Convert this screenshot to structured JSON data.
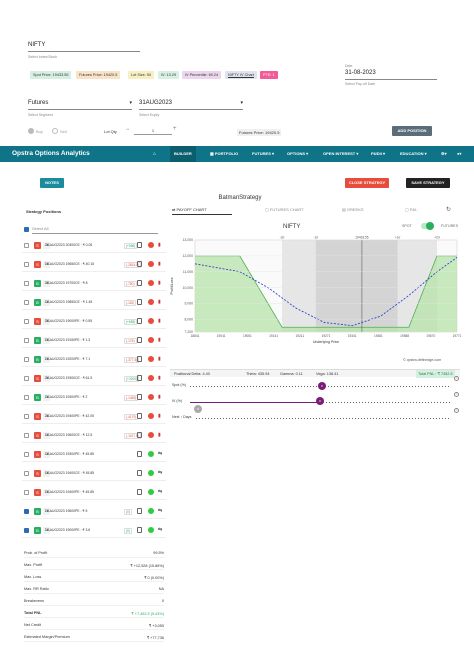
{
  "top": {
    "symbol": "NIFTY",
    "symbol_caption": "Select Index/Stock",
    "date_caption": "Date",
    "date": "31-08-2023",
    "date_sub": "Select Pay-off Date",
    "pills": [
      {
        "label": "Spot Price: 19433.55",
        "bg": "#d6efe3"
      },
      {
        "label": "Futures Price: 19420.5",
        "bg": "#f9e3c8"
      },
      {
        "label": "Lot Size: 50",
        "bg": "#f7f1c2"
      },
      {
        "label": "IV: 13.29",
        "bg": "#d7f0e4"
      },
      {
        "label": "IV Percentile: 60.24",
        "bg": "#ecd6ee"
      },
      {
        "label": "NIFTY IV Chart",
        "bg": "#dfe3ee"
      },
      {
        "label": "PTE: 1",
        "bg": "#f55a98"
      }
    ],
    "segment": "Futures",
    "segment_caption": "Select Segment",
    "expiry": "31AUG2023",
    "expiry_caption": "Select Expiry",
    "buy_label": "Buy",
    "sell_label": "Sell",
    "lot_qty_label": "Lot Qty",
    "lot_minus": "−",
    "lot_qty": "1",
    "lot_plus": "+",
    "fut_price": "Futures Price: 19420.5",
    "add_position": "ADD POSITION"
  },
  "nav": {
    "brand": "Opstra Options Analytics",
    "items": [
      "BUILDER",
      "PORTFOLIO",
      "FUTURES ▾",
      "OPTIONS ▾",
      "OPEN INTEREST ▾",
      "FII/DII ▾",
      "EDUCATION ▾"
    ]
  },
  "controls": {
    "notes": "NOTES",
    "strategy_name": "BatmanStrategy",
    "close_strategy": "CLOSE STRATEGY",
    "save_strategy": "SAVE STRATEGY"
  },
  "positions": {
    "title": "Strategy Positions",
    "select_all": "Select All",
    "rows": [
      {
        "side": "S",
        "qty": "2x",
        "desc": "31AUG2023 20300CE : ₹ 0.05",
        "pnl": "(+956)",
        "pos": true,
        "checked": false,
        "dot": "#e74c3c"
      },
      {
        "side": "S",
        "qty": "1x",
        "desc": "31AUG2023 19650CE : ₹ 40.15",
        "pnl": "(-2815.5)",
        "pos": false,
        "checked": false,
        "dot": "#e74c3c"
      },
      {
        "side": "B",
        "qty": "2x",
        "desc": "31AUG2023 19700CE : ₹ 8",
        "pnl": "(-750)",
        "pos": false,
        "checked": false,
        "dot": "#e74c3c"
      },
      {
        "side": "B",
        "qty": "1x",
        "desc": "31AUG2023 19850CE : ₹ 1.45",
        "pnl": "(-115)",
        "pos": false,
        "checked": false,
        "dot": "#e74c3c"
      },
      {
        "side": "S",
        "qty": "2x",
        "desc": "31AUG2023 19000PE : ₹ 0.55",
        "pnl": "(+685)",
        "pos": true,
        "checked": false,
        "dot": "#e74c3c"
      },
      {
        "side": "B",
        "qty": "1x",
        "desc": "31AUG2023 19150PE : ₹ 1.3",
        "pnl": "(-175)",
        "pos": false,
        "checked": false,
        "dot": "#e74c3c"
      },
      {
        "side": "B",
        "qty": "1x",
        "desc": "31AUG2023 19200PE : ₹ 7.1",
        "pnl": "(-377.5)",
        "pos": false,
        "checked": false,
        "dot": "#e74c3c"
      },
      {
        "side": "S",
        "qty": "2x",
        "desc": "31AUG2023 19300CE : ₹ 61.5",
        "pnl": "(+3200)",
        "pos": true,
        "checked": false,
        "dot": "#e74c3c"
      },
      {
        "side": "B",
        "qty": "1x",
        "desc": "31AUG2023 19300PE : ₹ 2",
        "pnl": "(-1465)",
        "pos": false,
        "checked": false,
        "dot": "#e74c3c"
      },
      {
        "side": "S",
        "qty": "2x",
        "desc": "31AUG2023 19400PE : ₹ 42.05",
        "pnl": "(-4170)",
        "pos": false,
        "checked": false,
        "dot": "#e74c3c"
      },
      {
        "side": "S",
        "qty": "1x",
        "desc": "31AUG2023 19600CE : ₹ 12.5",
        "pnl": "(-1107.5)",
        "pos": false,
        "checked": false,
        "dot": "#e74c3c"
      },
      {
        "side": "S",
        "qty": "1x",
        "desc": "31AUG2023 19300PE : ₹ 45.85",
        "pnl": "",
        "pos": true,
        "checked": false,
        "dot": "#2ecc40"
      },
      {
        "side": "S",
        "qty": "1x",
        "desc": "31AUG2023 19400CE : ₹ 45.85",
        "pnl": "",
        "pos": true,
        "checked": false,
        "dot": "#2ecc40"
      },
      {
        "side": "S",
        "qty": "1x",
        "desc": "31AUG2023 19400PE : ₹ 45.85",
        "pnl": "",
        "pos": true,
        "checked": false,
        "dot": "#2ecc40"
      },
      {
        "side": "B",
        "qty": "1x",
        "desc": "31AUG2023 19600PE : ₹ 5",
        "pnl": "(0)",
        "pos": true,
        "checked": true,
        "dot": "#2ecc40"
      },
      {
        "side": "B",
        "qty": "1x",
        "desc": "31AUG2023 19000PE : ₹ 3.6",
        "pnl": "(0)",
        "pos": true,
        "checked": true,
        "dot": "#2ecc40"
      }
    ]
  },
  "stats": [
    {
      "k": "Prob. of Profit",
      "v": "99.5%",
      "c": "#333"
    },
    {
      "k": "Max. Profit",
      "v": "₹ +12,528 (15.86%)",
      "c": "#333"
    },
    {
      "k": "Max. Loss",
      "v": "₹ 0 (0.00%)",
      "c": "#333"
    },
    {
      "k": "Max. RR Ratio",
      "v": "NA",
      "c": "#333"
    },
    {
      "k": "Breakevens",
      "v": "0",
      "c": "#333"
    },
    {
      "k": "Total PNL",
      "v": "₹ +7,452.5 (9.43%)",
      "c": "#27ae60"
    },
    {
      "k": "Net Credit",
      "v": "₹ +3,055",
      "c": "#333"
    },
    {
      "k": "Estimated Margin/Premium",
      "v": "₹ +77,736",
      "c": "#333"
    }
  ],
  "tabs": {
    "payoff": "PAYOFF CHART",
    "futures": "FUTURES CHART",
    "greeks": "GREEKS",
    "pnl": "P&L"
  },
  "toggle": {
    "spot": "SPOT",
    "futures": "FUTURES"
  },
  "greeks_bar": {
    "delta": "Positional Delta: 4.40",
    "theta": "Theta: 435.94",
    "gamma": "Gamma: 0.11",
    "vega": "Vega: 138.41",
    "total": "Total PNL : ₹ 7452.5"
  },
  "watermark": "© opstra.definedge.com",
  "sliders": {
    "spot": "Spot (%)",
    "iv": "IV (%)",
    "days": "Next ↑ Days",
    "spot_thumb": "0",
    "iv_thumb": "0",
    "days_thumb": "0"
  },
  "chart_data": {
    "type": "line",
    "title": "NIFTY",
    "xlabel": "Underlying Price",
    "ylabel": "Profit/Loss",
    "x_ticks": [
      "18841",
      "19041",
      "19051",
      "19141",
      "19211",
      "19271",
      "19341",
      "19481",
      "19588",
      "19670",
      "19771"
    ],
    "y_ticks": [
      "0",
      "7,200",
      "8,000",
      "9,000",
      "10,000",
      "11,000",
      "12,000",
      "13,000"
    ],
    "top_ticks": [
      "-2σ",
      "-1σ",
      "19433.55",
      "+1σ",
      "+2σ"
    ],
    "ylim": [
      7200,
      13000
    ],
    "expiry_series": {
      "x": [
        18841,
        19000,
        19150,
        19200,
        19300,
        19400,
        19500,
        19600,
        19700,
        19771
      ],
      "y": [
        12000,
        12000,
        7500,
        7500,
        7500,
        7500,
        7500,
        7500,
        12000,
        12000
      ]
    },
    "target_series": {
      "x": [
        18841,
        19000,
        19100,
        19200,
        19300,
        19400,
        19500,
        19600,
        19700,
        19771
      ],
      "y": [
        11500,
        11000,
        10000,
        8700,
        7800,
        7600,
        8200,
        9500,
        11000,
        11900
      ]
    },
    "colors": {
      "expiry_fill": "#b7e3a8",
      "expiry_line": "#4caf50",
      "target_line": "#3344cc",
      "band_fill": "#d9d9d9"
    }
  }
}
